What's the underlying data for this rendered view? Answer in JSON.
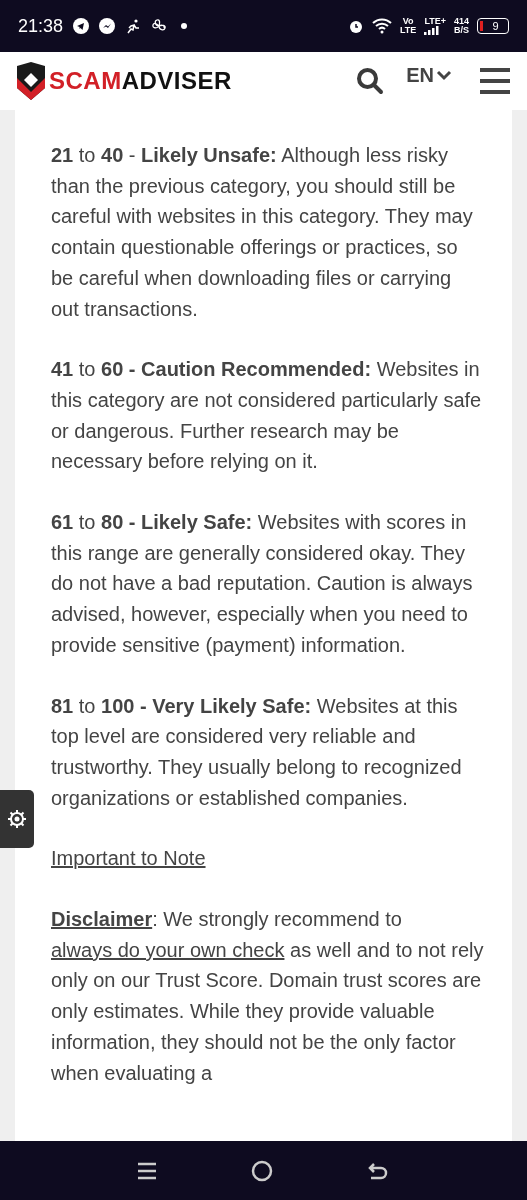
{
  "status_bar": {
    "time": "21:38",
    "volte": [
      "Vo",
      "LTE"
    ],
    "network": "LTE+",
    "speed": [
      "414",
      "B/S"
    ],
    "battery": "9"
  },
  "header": {
    "logo": [
      "SCAM",
      "ADVISER"
    ],
    "language": "EN"
  },
  "paragraphs": [
    {
      "kind": "text",
      "text": "**21** to **40** -  **Likely Unsafe:** Although less risky than the previous category, you should still be careful with websites in this category. They may contain questionable offerings or practices, so be careful when downloading files or carrying out transactions."
    },
    {
      "kind": "text",
      "text": "**41** to **60 - Caution Recommended:** Websites in this category are not considered particularly safe or dangerous. Further research may be necessary before relying on it."
    },
    {
      "kind": "text",
      "text": "**61** to **80 - Likely Safe:** Websites with scores in this range are generally considered okay. They do not have a bad reputation. Caution is always advised, however, especially when you need to provide sensitive (payment) information."
    },
    {
      "kind": "text",
      "text": "**81** to **100 - Very Likely Safe:** Websites at this top level are considered very reliable and trustworthy. They usually belong to recognized organizations or established companies."
    },
    {
      "kind": "link",
      "text": "Important to Note"
    },
    {
      "kind": "disclaimer",
      "label": "Disclaimer",
      "text_1": ": We strongly recommend to ",
      "link": "always do your own check",
      "text_2": " as well and to not rely only on our Trust Score. Domain trust scores are only estimates. While they provide valuable information, they should not be the only factor when evaluating a"
    }
  ]
}
